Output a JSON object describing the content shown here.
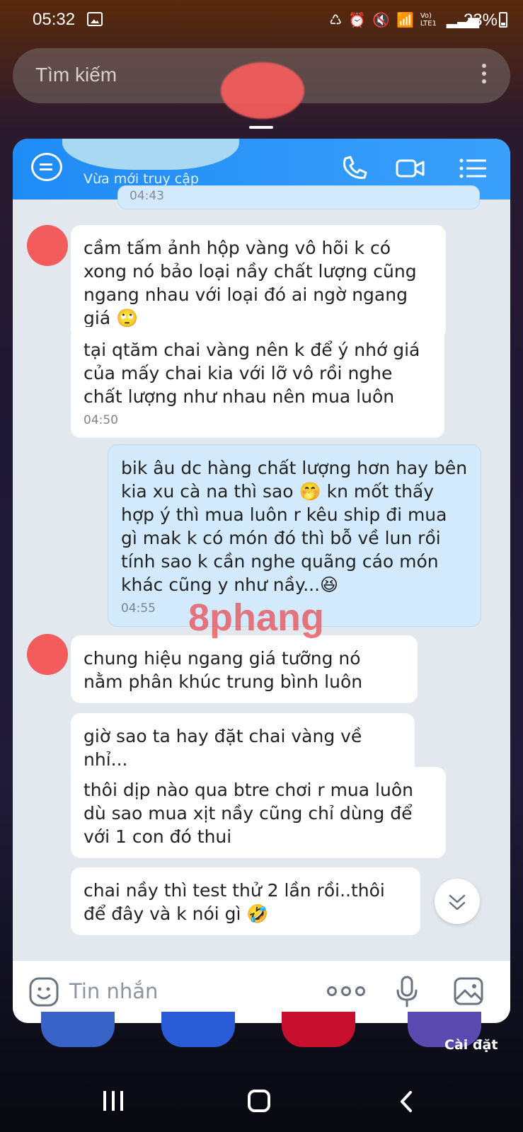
{
  "status_bar": {
    "time": "05:32",
    "battery": "23%",
    "signal_text": "Vo) LTE1"
  },
  "search": {
    "placeholder": "Tìm kiếm"
  },
  "chat": {
    "status": "Vừa mới truy cập",
    "previous_time": "04:43",
    "messages": [
      {
        "sender": "other",
        "text": "cầm tấm ảnh hộp vàng vô hõi k có xong nó bảo loại nầy chất lượng cũng ngang nhau với loại đó ai ngờ ngang giá 🙄"
      },
      {
        "sender": "other",
        "text": "tại qtăm chai vàng nên k để ý nhớ giá của mấy chai kia với lỡ vô rồi nghe chất lượng như nhau nên mua luôn",
        "time": "04:50"
      },
      {
        "sender": "me",
        "text": "bik âu dc hàng chất lượng hơn hay bên kia xu cà na thì sao 🤭 kn mốt thấy hợp ý thì mua luôn r kêu ship đi mua gì mak k có món đó thì bỗ về lun rồi tính sao  k cần nghe quãng cáo món khác cũng y như nầy...😆",
        "time": "04:55"
      },
      {
        "sender": "other",
        "text": "chung hiệu ngang giá tưỡng nó nằm phân khúc trung bình luôn"
      },
      {
        "sender": "other",
        "text": "giờ sao ta hay đặt chai vàng về nhỉ..."
      },
      {
        "sender": "other",
        "text": "thôi dịp nào qua btre chơi r mua luôn dù sao mua xịt nầy cũng chỉ dùng để với 1 con đó thui"
      },
      {
        "sender": "other",
        "text": "chai nầy thì test thử 2 lần rồi..thôi để đây và k nói gì 🤣"
      }
    ],
    "watermark": "8phang"
  },
  "input": {
    "placeholder": "Tin nhắn"
  },
  "dock": {
    "settings_label": "Cài đặt"
  },
  "colors": {
    "header": "#1f8bf5",
    "my_bubble": "#d2eafb",
    "other_bubble": "#ffffff",
    "chat_bg": "#e3e8ee"
  }
}
